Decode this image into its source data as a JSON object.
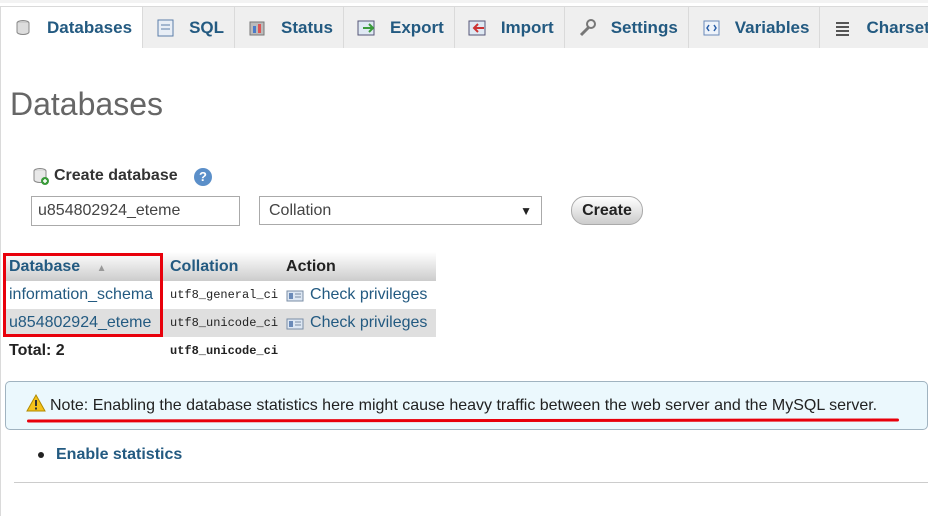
{
  "tabs": [
    {
      "label": "Databases",
      "icon": "database-icon",
      "active": true
    },
    {
      "label": "SQL",
      "icon": "sql-icon"
    },
    {
      "label": "Status",
      "icon": "status-icon"
    },
    {
      "label": "Export",
      "icon": "export-icon"
    },
    {
      "label": "Import",
      "icon": "import-icon"
    },
    {
      "label": "Settings",
      "icon": "wrench-icon"
    },
    {
      "label": "Variables",
      "icon": "variables-icon"
    },
    {
      "label": "Charset",
      "icon": "charset-icon"
    }
  ],
  "page_title": "Databases",
  "create": {
    "label": "Create database",
    "db_name_value": "u854802924_eteme",
    "collation_selected": "Collation",
    "button_label": "Create",
    "help_glyph": "?"
  },
  "table": {
    "headers": {
      "database": "Database",
      "collation": "Collation",
      "action": "Action"
    },
    "rows": [
      {
        "database": "information_schema",
        "collation": "utf8_general_ci",
        "action": "Check privileges"
      },
      {
        "database": "u854802924_eteme",
        "collation": "utf8_unicode_ci",
        "action": "Check privileges"
      }
    ],
    "total": {
      "label": "Total: 2",
      "collation": "utf8_unicode_ci"
    }
  },
  "notice": {
    "text": "Note: Enabling the database statistics here might cause heavy traffic between the web server and the MySQL server."
  },
  "enable_statistics": "Enable statistics",
  "colors": {
    "link": "#235a81",
    "annotation_red": "#e8000b",
    "notice_bg": "#ebf8fd"
  }
}
